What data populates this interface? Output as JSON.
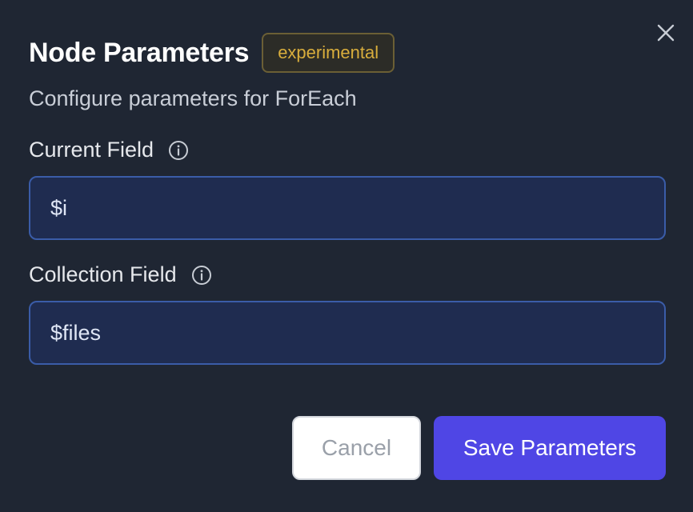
{
  "dialog": {
    "title": "Node Parameters",
    "badge": "experimental",
    "subtitle": "Configure parameters for ForEach",
    "close_icon": "close-icon"
  },
  "fields": [
    {
      "label": "Current Field",
      "value": "$i",
      "info_icon": "info-icon"
    },
    {
      "label": "Collection Field",
      "value": "$files",
      "info_icon": "info-icon"
    }
  ],
  "actions": {
    "cancel_label": "Cancel",
    "save_label": "Save Parameters"
  },
  "colors": {
    "background": "#1f2633",
    "badge_text": "#d8ad3c",
    "input_background": "#1f2c50",
    "input_border": "#3a5ca8",
    "primary": "#4f46e5"
  }
}
